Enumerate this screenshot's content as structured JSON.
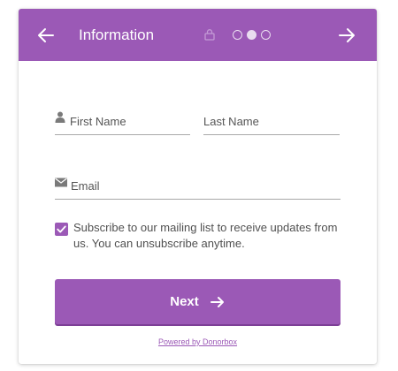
{
  "header": {
    "title": "Information",
    "steps": [
      "inactive",
      "active",
      "inactive"
    ]
  },
  "form": {
    "first_name_placeholder": "First Name",
    "last_name_placeholder": "Last Name",
    "email_placeholder": "Email",
    "subscribe_checked": true,
    "subscribe_label": "Subscribe to our mailing list to receive updates from us. You can unsubscribe anytime."
  },
  "actions": {
    "next_label": "Next"
  },
  "footer": {
    "powered_by": "Powered by Donorbox"
  },
  "colors": {
    "accent": "#9b59b6",
    "header_text": "#ffffff",
    "field_line": "#a8a8a8",
    "placeholder_text": "#555555"
  },
  "icons": [
    "back-arrow-icon",
    "lock-icon",
    "forward-arrow-icon",
    "user-icon",
    "envelope-icon",
    "check-icon",
    "next-arrow-icon"
  ]
}
